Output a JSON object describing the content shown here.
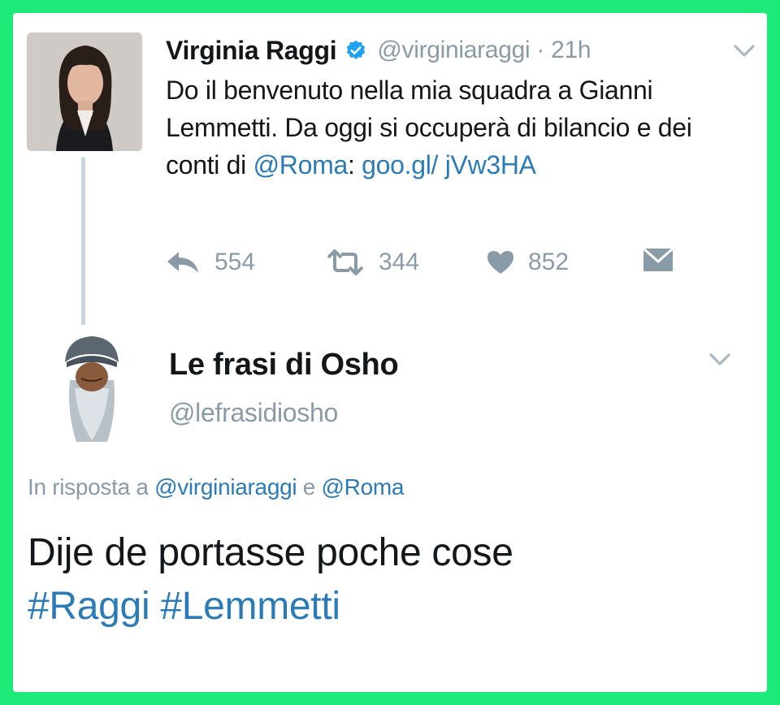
{
  "colors": {
    "frame_border": "#1eea7a",
    "link": "#2b7bb9",
    "muted": "#8a9ba8",
    "text": "#14171a",
    "verified": "#1da1f2"
  },
  "tweet": {
    "author_name": "Virginia Raggi",
    "verified_icon": "verified-badge-icon",
    "handle": "@virginiaraggi",
    "separator": " · ",
    "time": "21h",
    "text_before": "Do il benvenuto nella mia squadra a Gianni Lemmetti. Da oggi si occuperà di bilancio e dei conti di ",
    "mention": "@Roma",
    "text_between": ": ",
    "link": "goo.gl/ jVw3HA",
    "actions": {
      "reply": {
        "icon": "reply-icon",
        "count": "554"
      },
      "retweet": {
        "icon": "retweet-icon",
        "count": "344"
      },
      "like": {
        "icon": "heart-icon",
        "count": "852"
      },
      "dm": {
        "icon": "envelope-icon"
      }
    }
  },
  "reply": {
    "author_name": "Le frasi di Osho",
    "handle": "@lefrasidiosho",
    "in_reply_prefix": "In risposta a ",
    "in_reply_user1": "@virginiaraggi",
    "in_reply_and": " e ",
    "in_reply_user2": "@Roma",
    "text": "Dije de portasse poche cose",
    "hashtag1": "#Raggi",
    "hashtag2": "#Lemmetti"
  }
}
